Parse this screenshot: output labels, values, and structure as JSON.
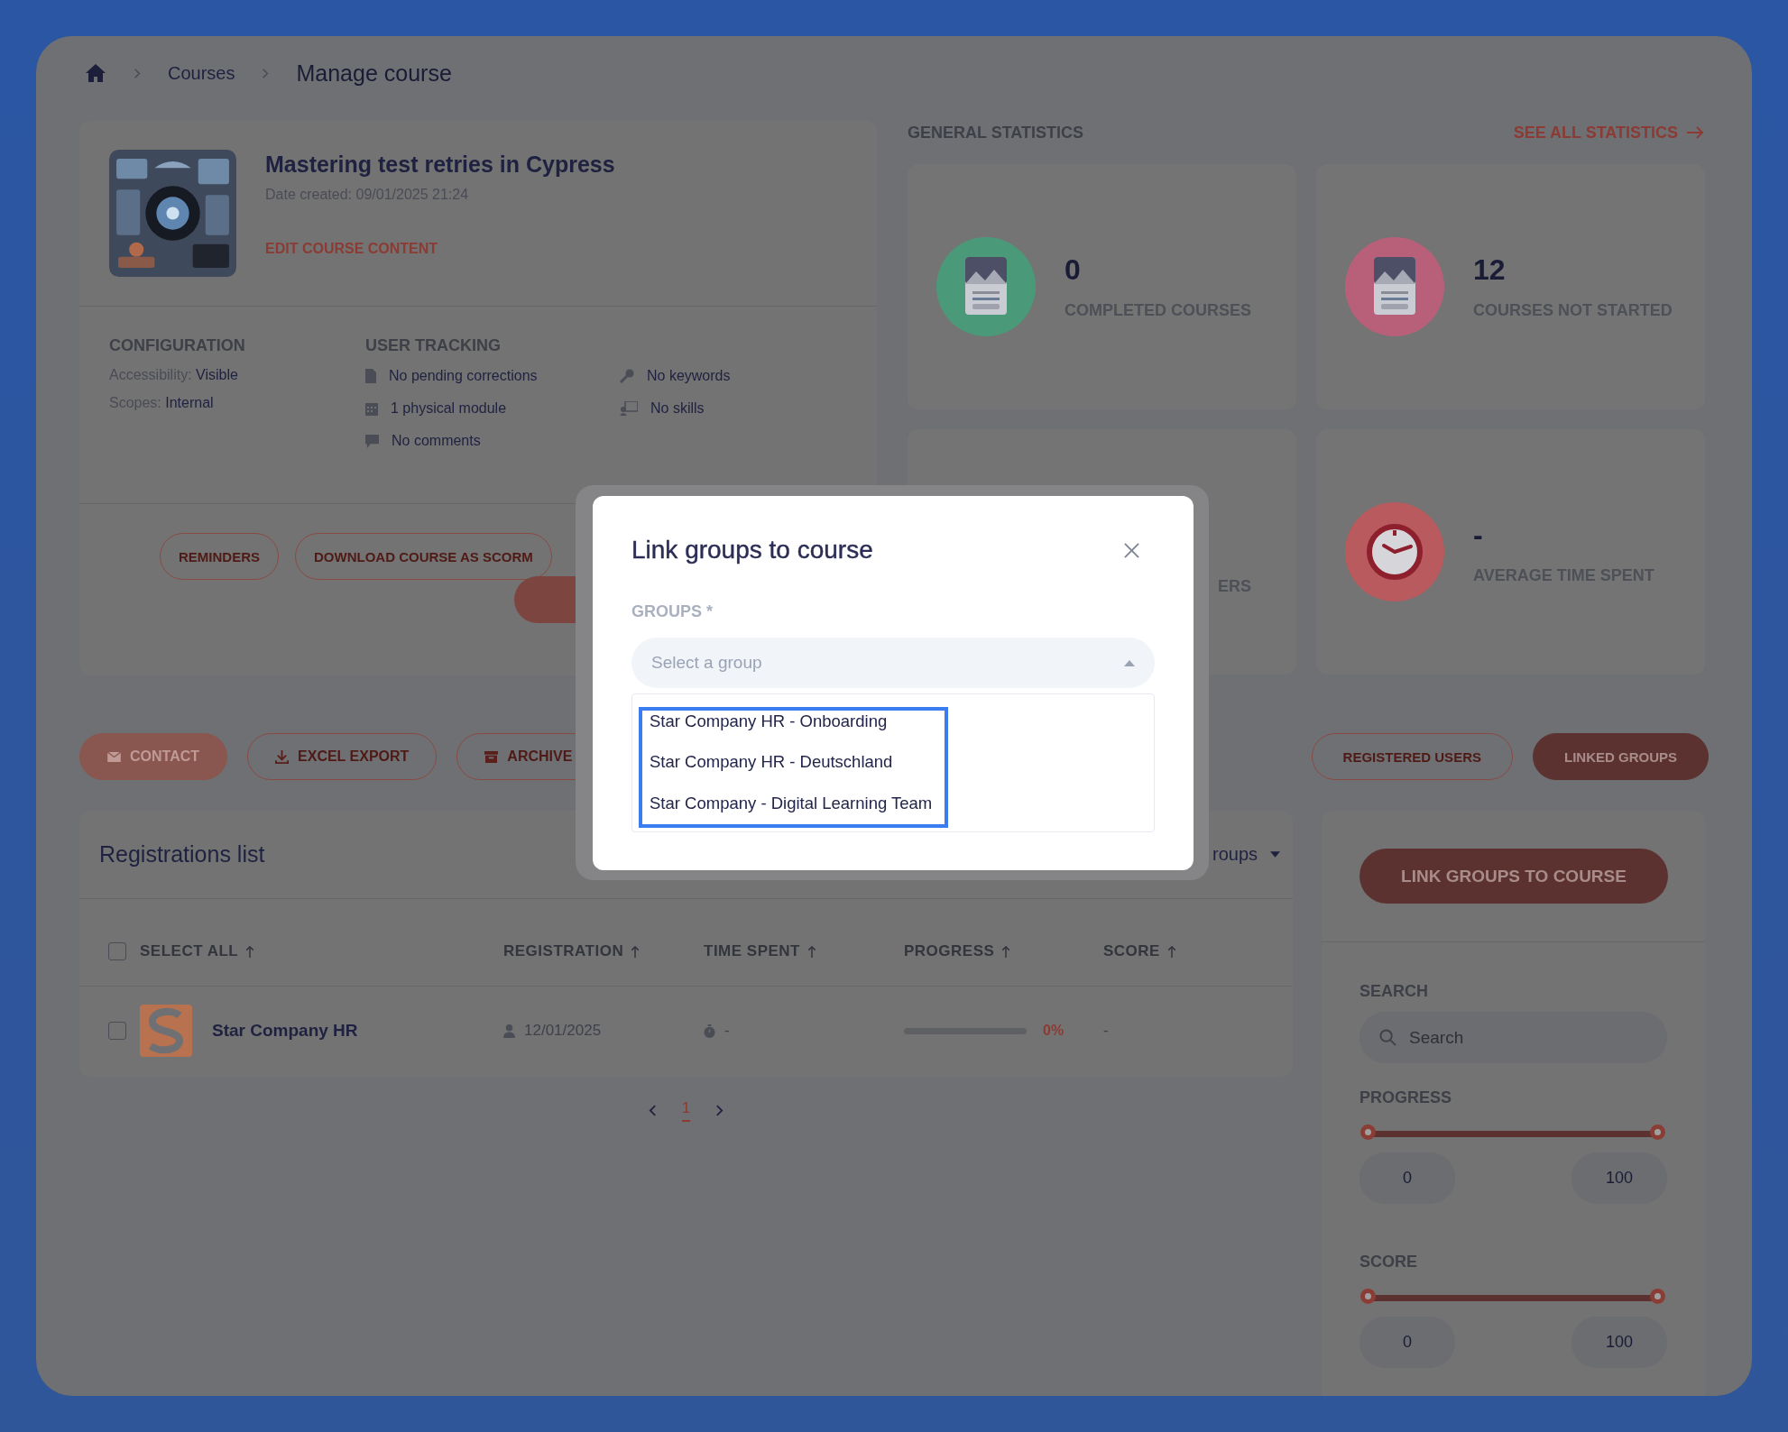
{
  "breadcrumbs": [
    {
      "kind": "home",
      "current": false
    },
    {
      "kind": "text",
      "label": "Courses",
      "current": false
    },
    {
      "kind": "text",
      "label": "Manage course",
      "current": true
    }
  ],
  "course": {
    "title": "Mastering test retries in Cypress",
    "date": "Date created: 09/01/2025 21:24",
    "edit_link": "EDIT COURSE CONTENT"
  },
  "configuration": {
    "title": "CONFIGURATION",
    "items": [
      {
        "label": "Accessibility:",
        "value": "Visible"
      },
      {
        "label": "Scopes:",
        "value": "Internal"
      }
    ]
  },
  "tracking": {
    "title": "USER TRACKING",
    "items": [
      {
        "kind": "file",
        "text": "No pending corrections"
      },
      {
        "kind": "key",
        "text": "No keywords"
      },
      {
        "kind": "calendar",
        "text": "1 physical module"
      },
      {
        "kind": "skills",
        "text": "No skills"
      },
      {
        "kind": "comment",
        "text": "No comments"
      }
    ]
  },
  "course_buttons": [
    "REMINDERS",
    "DOWNLOAD COURSE AS SCORM"
  ],
  "statistics": {
    "title": "GENERAL STATISTICS",
    "link": "SEE ALL STATISTICS",
    "cards": [
      {
        "kind": "document",
        "color": "#4a9a7a",
        "value": "0",
        "label": "COMPLETED COURSES"
      },
      {
        "kind": "document",
        "color": "#b8607a",
        "value": "12",
        "label": "COURSES NOT STARTED"
      },
      {
        "kind": "covered",
        "label": "ERS"
      },
      {
        "kind": "clock",
        "color": "#b85a5e",
        "value": "-",
        "label": "AVERAGE TIME SPENT"
      }
    ]
  },
  "actions": [
    {
      "kind": "mail",
      "label": "CONTACT",
      "filled": true
    },
    {
      "kind": "download",
      "label": "EXCEL EXPORT",
      "filled": false
    },
    {
      "kind": "archive",
      "label": "ARCHIVE",
      "filled": false
    }
  ],
  "view_tabs": [
    {
      "label": "REGISTERED USERS",
      "selected": false
    },
    {
      "label": "LINKED GROUPS",
      "selected": true
    }
  ],
  "registrations": {
    "title": "Registrations list",
    "filter": "roups",
    "select_all_checked": false,
    "columns": [
      "SELECT ALL",
      "REGISTRATION",
      "TIME SPENT",
      "PROGRESS",
      "SCORE"
    ],
    "rows": [
      {
        "checked": false,
        "name": "Star Company HR",
        "registration": "12/01/2025",
        "time_spent": "-",
        "level": 0,
        "progress": "0%",
        "score": "-"
      }
    ]
  },
  "pagination": [
    {
      "label": "1",
      "selected": true
    }
  ],
  "sidebar": {
    "button": "LINK GROUPS TO COURSE",
    "search": {
      "title": "SEARCH",
      "placeholder": "Search"
    },
    "ranges": [
      {
        "title": "PROGRESS",
        "thumbs": [
          {
            "level": 0
          },
          {
            "level": 1
          }
        ],
        "min": "0",
        "max": "100"
      },
      {
        "title": "SCORE",
        "thumbs": [
          {
            "level": 0
          },
          {
            "level": 1
          }
        ],
        "min": "0",
        "max": "100"
      }
    ]
  },
  "modal": {
    "title": "Link groups to course",
    "field_label": "GROUPS *",
    "placeholder": "Select a group",
    "expanded": true,
    "focused": true,
    "options": [
      "Star Company HR - Onboarding",
      "Star Company HR - Deutschland",
      "Star Company - Digital Learning Team"
    ]
  }
}
